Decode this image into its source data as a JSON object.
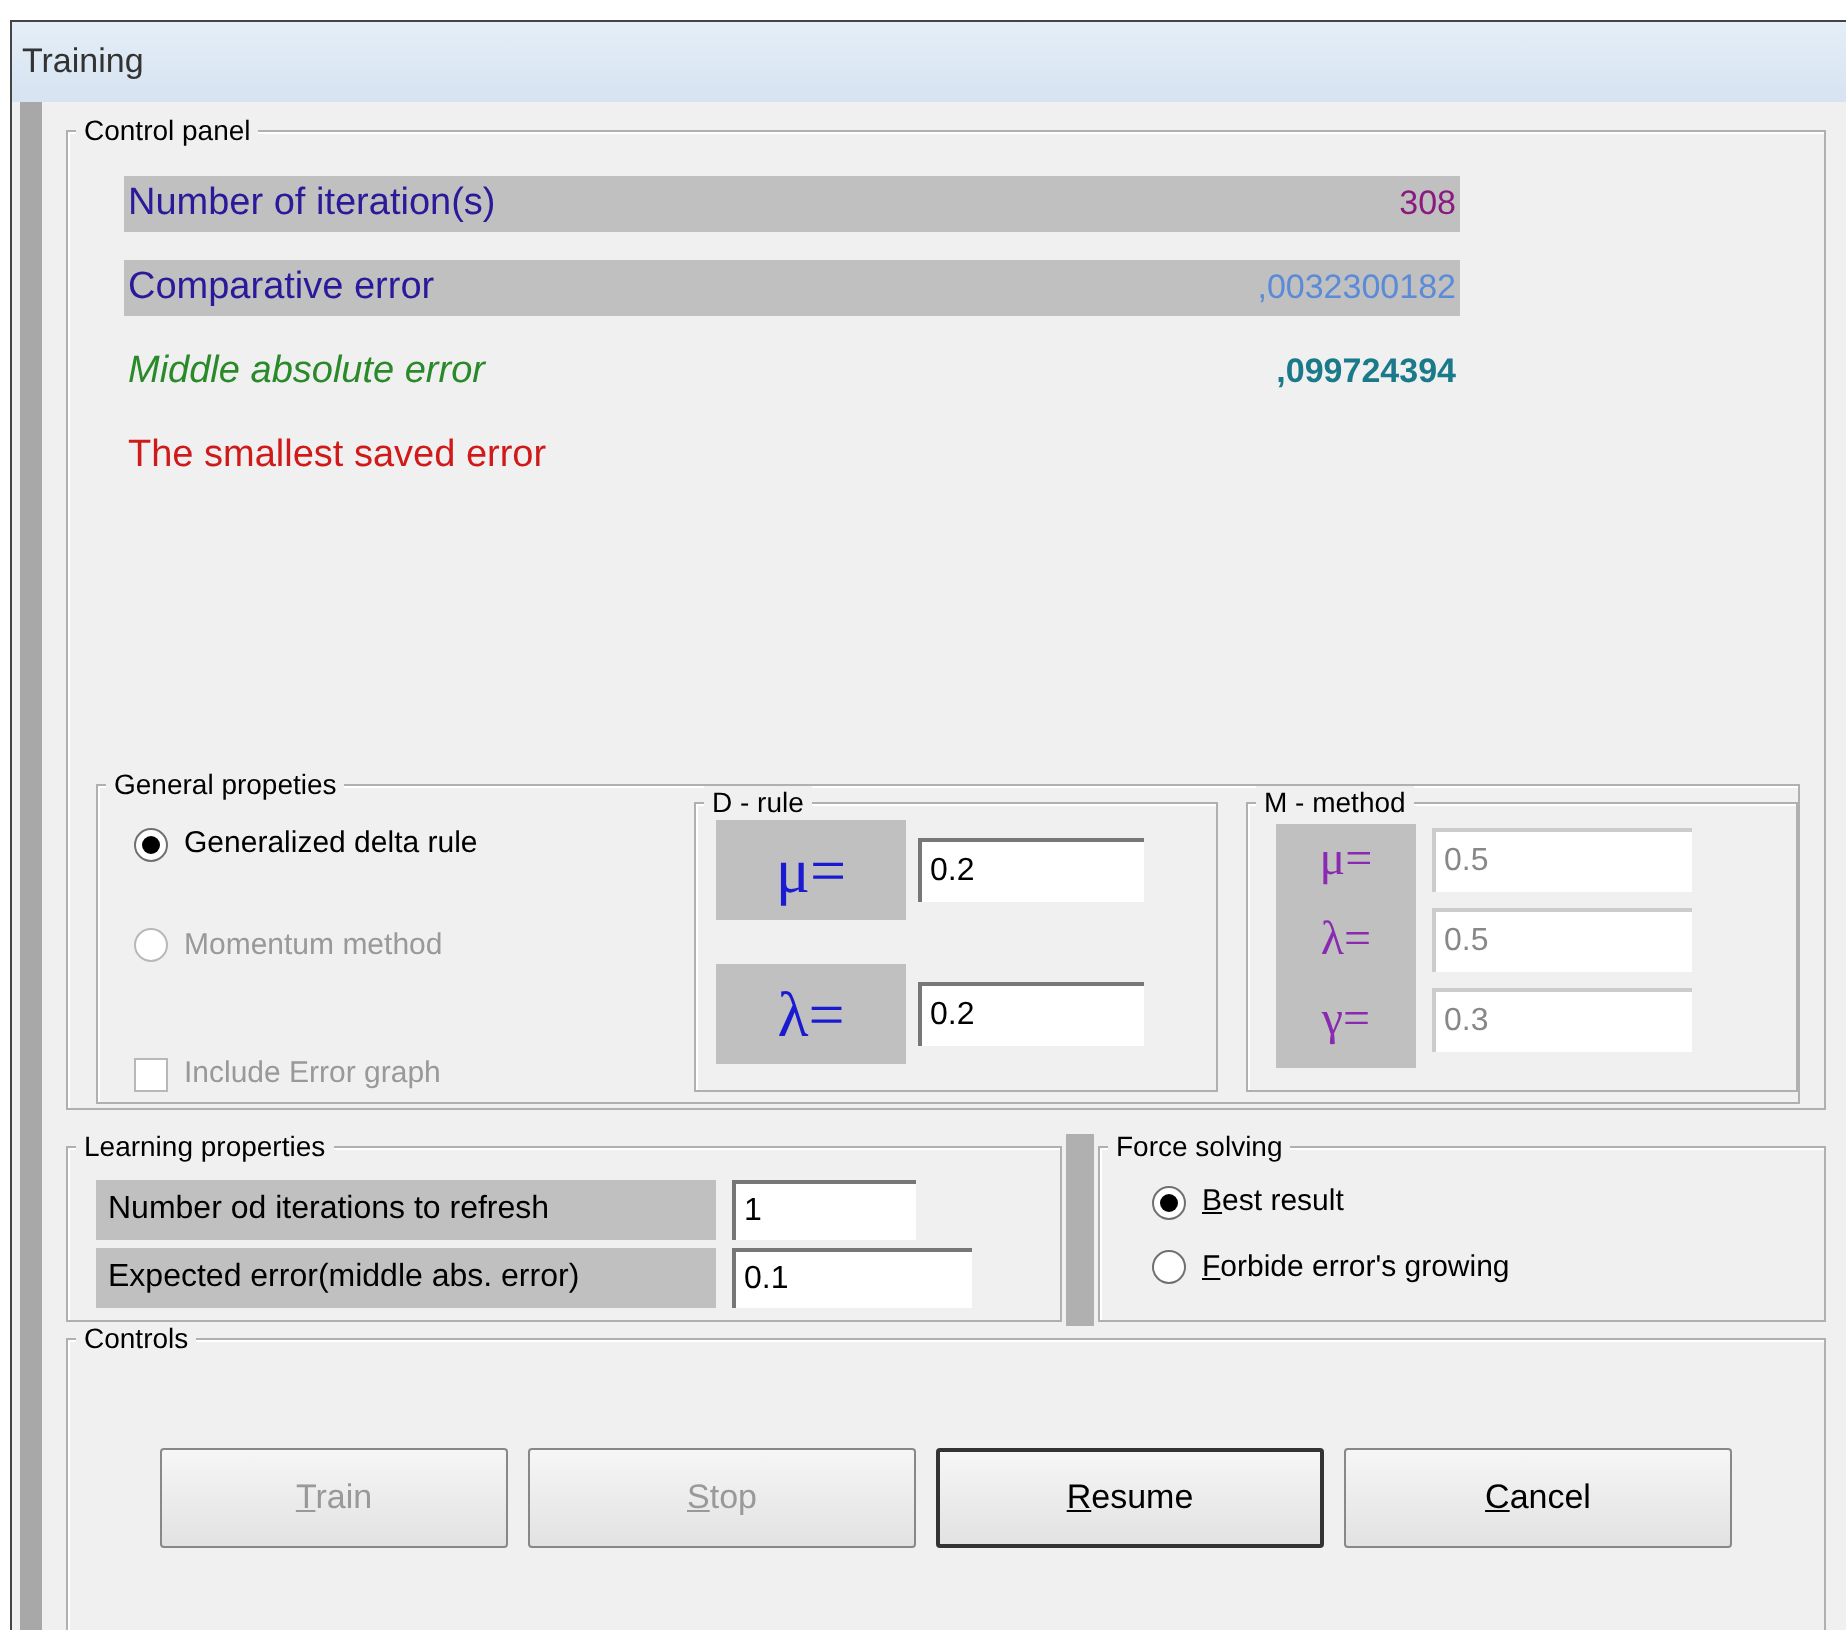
{
  "window": {
    "title": "Training"
  },
  "control_panel": {
    "title": "Control panel",
    "rows": [
      {
        "label": "Number of iteration(s)",
        "value": "308",
        "kind": "iterations"
      },
      {
        "label": "Comparative error",
        "value": ",0032300182",
        "kind": "comparative"
      },
      {
        "label": "Middle absolute error",
        "value": ",099724394",
        "kind": "middle"
      },
      {
        "label": "The smallest saved error",
        "kind": "smallest"
      }
    ]
  },
  "general_properties": {
    "title": "General propeties",
    "options": [
      {
        "label": "Generalized delta rule",
        "selected": true,
        "disabled": false
      },
      {
        "label": "Momentum method",
        "selected": false,
        "disabled": true
      }
    ],
    "include_error_graph": {
      "label": "Include Error graph",
      "checked": false,
      "disabled": true
    },
    "d_rule": {
      "title": "D - rule",
      "params": [
        {
          "symbol": "μ=",
          "value": "0.2",
          "disabled": false
        },
        {
          "symbol": "λ=",
          "value": "0.2",
          "disabled": false
        }
      ]
    },
    "m_method": {
      "title": "M - method",
      "params": [
        {
          "symbol": "μ=",
          "value": "0.5",
          "disabled": true
        },
        {
          "symbol": "λ=",
          "value": "0.5",
          "disabled": true
        },
        {
          "symbol": "γ=",
          "value": "0.3",
          "disabled": true
        }
      ]
    }
  },
  "learning_properties": {
    "title": "Learning properties",
    "fields": [
      {
        "label": "Number od iterations to refresh",
        "value": "1"
      },
      {
        "label": "Expected error(middle abs. error)",
        "value": "0.1"
      }
    ]
  },
  "force_solving": {
    "title": "Force solving",
    "options": [
      {
        "label": "Best result",
        "selected": true
      },
      {
        "label": "Forbide error's growing",
        "selected": false
      }
    ]
  },
  "controls": {
    "title": "Controls",
    "buttons": [
      {
        "label": "Train",
        "disabled": true,
        "default": false
      },
      {
        "label": "Stop",
        "disabled": true,
        "default": false
      },
      {
        "label": "Resume",
        "disabled": false,
        "default": true
      },
      {
        "label": "Cancel",
        "disabled": false,
        "default": false
      }
    ]
  }
}
